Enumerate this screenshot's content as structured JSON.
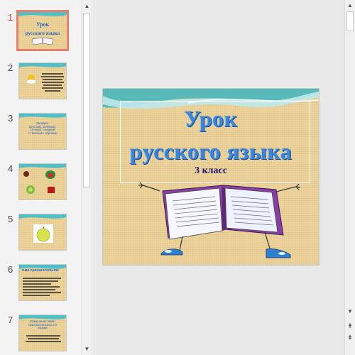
{
  "slides": [
    {
      "number": "1",
      "active": true,
      "title_line1": "Урок",
      "title_line2": "русского  языка",
      "subtitle": "3 класс"
    },
    {
      "number": "2",
      "active": false,
      "text": "~~~~~~~~~~~~~~~\n~~~~~~~~~~~~~~~\n~~~~~~~~~~~~~~~\n~~~~~~~~~~~~~~~\n~~~~~~~~~~~~~~~"
    },
    {
      "number": "3",
      "active": false,
      "text": "Загадка:\nкруглый, зелёный,\nсочный, сладкий\nс тёмными зёрнами"
    },
    {
      "number": "4",
      "active": false
    },
    {
      "number": "5",
      "active": false
    },
    {
      "number": "6",
      "active": false,
      "text": "Имя прилагательное"
    },
    {
      "number": "7",
      "active": false,
      "text": "Изменение имён\nприлагательных по\nродам"
    }
  ],
  "main_slide": {
    "title_line1": "Урок",
    "title_line2": "русского  языка",
    "subtitle": "3 класс"
  },
  "colors": {
    "slide_background": "#ecd49c",
    "title_blue": "#3c86d8",
    "active_border": "#e8806a",
    "active_number": "#d24726"
  },
  "icons": {
    "scroll_up": "▲",
    "scroll_down": "▼",
    "prev_slide": "⇞",
    "next_slide": "⇟"
  }
}
